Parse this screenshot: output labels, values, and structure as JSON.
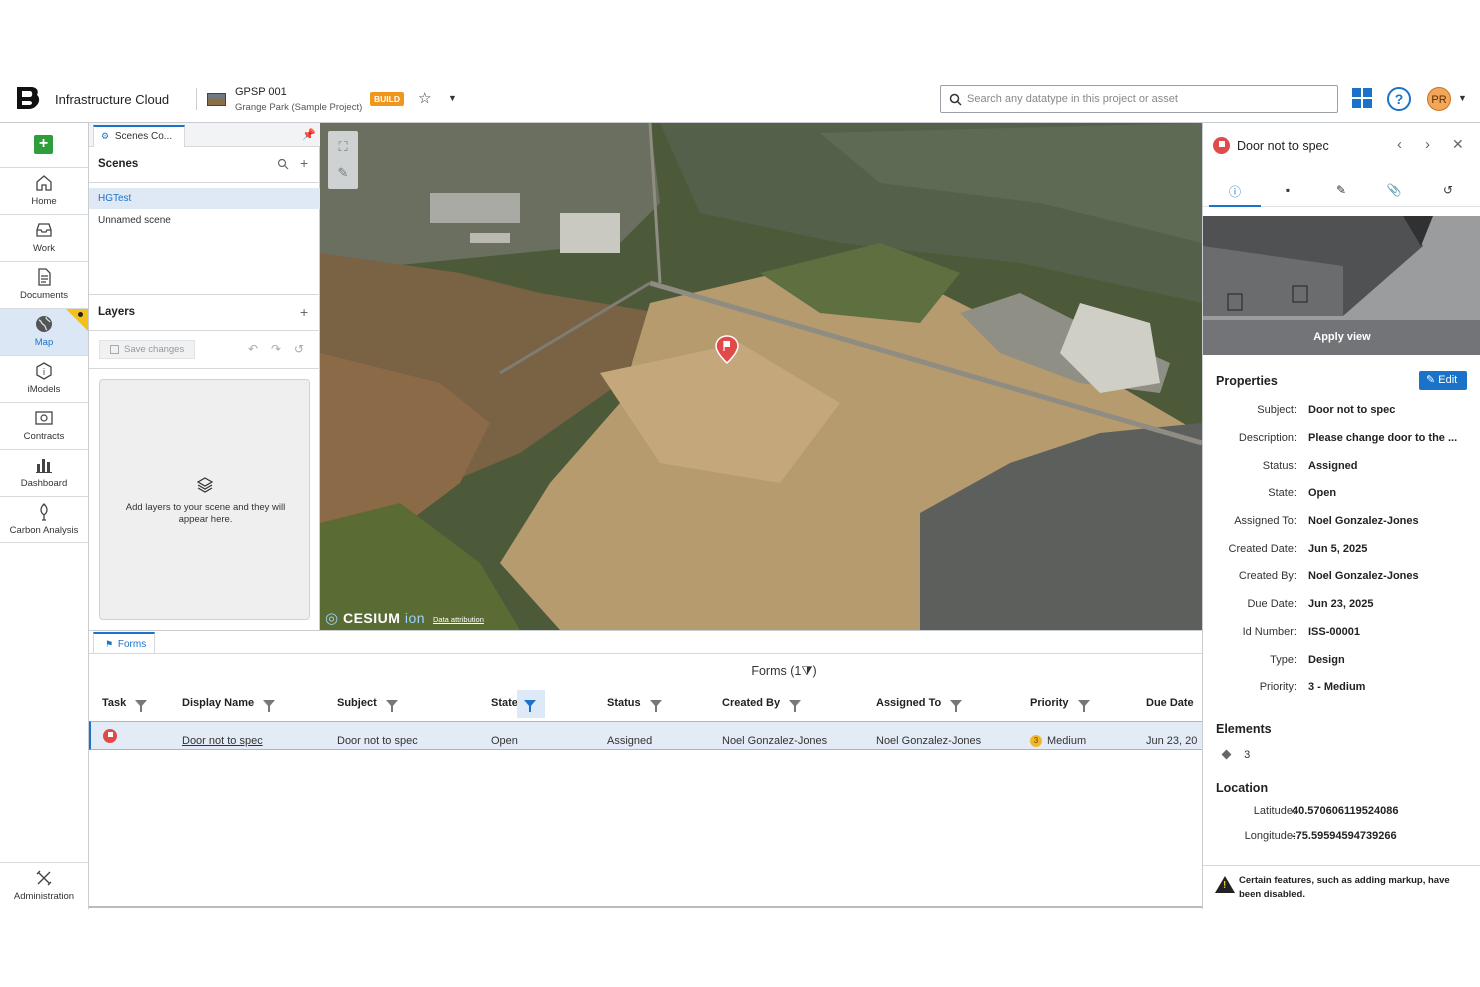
{
  "header": {
    "brand": "Infrastructure Cloud",
    "project_name": "GPSP 001",
    "project_sub": "Grange Park (Sample Project)",
    "badge": "BUILD",
    "search_placeholder": "Search any datatype in this project or asset",
    "avatar_initials": "PR",
    "help_label": "?"
  },
  "leftnav": {
    "add_label": "+",
    "items": [
      {
        "label": "Home",
        "icon": "home-icon"
      },
      {
        "label": "Work",
        "icon": "inbox-icon"
      },
      {
        "label": "Documents",
        "icon": "document-icon"
      },
      {
        "label": "Map",
        "icon": "globe-icon",
        "active": true
      },
      {
        "label": "iModels",
        "icon": "imodel-icon"
      },
      {
        "label": "Contracts",
        "icon": "contract-icon"
      },
      {
        "label": "Dashboard",
        "icon": "chart-icon"
      },
      {
        "label": "Carbon Analysis",
        "icon": "carbon-icon"
      }
    ],
    "admin_label": "Administration"
  },
  "scenes": {
    "tab_label": "Scenes Co...",
    "heading": "Scenes",
    "items": [
      "HGTest",
      "Unnamed scene"
    ],
    "layers_heading": "Layers",
    "save_label": "Save changes",
    "empty_message": "Add layers to your scene and they will appear here."
  },
  "map": {
    "cesium_brand": "CESIUM",
    "cesium_ion": "ion",
    "attribution": "Data attribution"
  },
  "forms": {
    "tab_label": "Forms",
    "title": "Forms (1⧩)",
    "columns": [
      "Task",
      "Display Name",
      "Subject",
      "State",
      "Status",
      "Created By",
      "Assigned To",
      "Priority",
      "Due Date"
    ],
    "row": {
      "display_name": "Door not to spec",
      "subject": "Door not to spec",
      "state": "Open",
      "status": "Assigned",
      "created_by": "Noel Gonzalez-Jones",
      "assigned_to": "Noel Gonzalez-Jones",
      "priority_num": "3",
      "priority": "Medium",
      "due_date": "Jun 23, 20"
    }
  },
  "detail": {
    "title": "Door not to spec",
    "apply_view": "Apply view",
    "properties_heading": "Properties",
    "edit_label": "Edit",
    "properties": [
      {
        "label": "Subject:",
        "value": "Door not to spec"
      },
      {
        "label": "Description:",
        "value": "Please change door to the ..."
      },
      {
        "label": "Status:",
        "value": "Assigned"
      },
      {
        "label": "State:",
        "value": "Open"
      },
      {
        "label": "Assigned To:",
        "value": "Noel Gonzalez-Jones"
      },
      {
        "label": "Created Date:",
        "value": "Jun 5, 2025"
      },
      {
        "label": "Created By:",
        "value": "Noel Gonzalez-Jones"
      },
      {
        "label": "Due Date:",
        "value": "Jun 23, 2025"
      },
      {
        "label": "Id Number:",
        "value": "ISS-00001"
      },
      {
        "label": "Type:",
        "value": "Design"
      },
      {
        "label": "Priority:",
        "value": "3 - Medium"
      }
    ],
    "elements_heading": "Elements",
    "elements_count": "3",
    "location_heading": "Location",
    "latitude_label": "Latitude:",
    "latitude": "40.570606119524086",
    "longitude_label": "Longitude:",
    "longitude": "-75.59594594739266",
    "warning": "Certain features, such as adding markup, have been disabled."
  },
  "colors": {
    "accent": "#1a73c9",
    "badge": "#f0961c",
    "flag": "#e24a4a",
    "add": "#2e9e3b"
  }
}
